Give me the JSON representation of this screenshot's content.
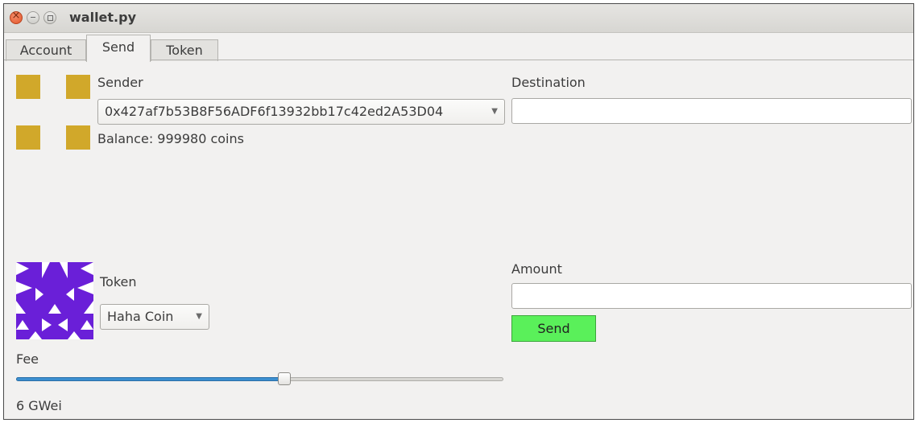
{
  "window": {
    "title": "wallet.py",
    "controls": {
      "close": "close-icon",
      "minimize": "minimize-icon",
      "maximize": "maximize-icon"
    }
  },
  "tabs": [
    {
      "label": "Account",
      "selected": false
    },
    {
      "label": "Send",
      "selected": true
    },
    {
      "label": "Token",
      "selected": false
    }
  ],
  "sender": {
    "label": "Sender",
    "selected_address": "0x427af7b53B8F56ADF6f13932bb17c42ed2A53D04",
    "balance_text": "Balance: 999980 coins"
  },
  "destination": {
    "label": "Destination",
    "value": "",
    "placeholder": ""
  },
  "token": {
    "label": "Token",
    "selected": "Haha Coin"
  },
  "amount": {
    "label": "Amount",
    "value": "",
    "placeholder": ""
  },
  "send_button": {
    "label": "Send",
    "color": "#5af05a"
  },
  "fee": {
    "label": "Fee",
    "slider_fraction": 0.55,
    "value_text": "6 GWei"
  },
  "colors": {
    "sender_identicon": "#d1a82a",
    "token_identicon": "#6a1fd8",
    "slider_fill": "#3c8fd0"
  }
}
